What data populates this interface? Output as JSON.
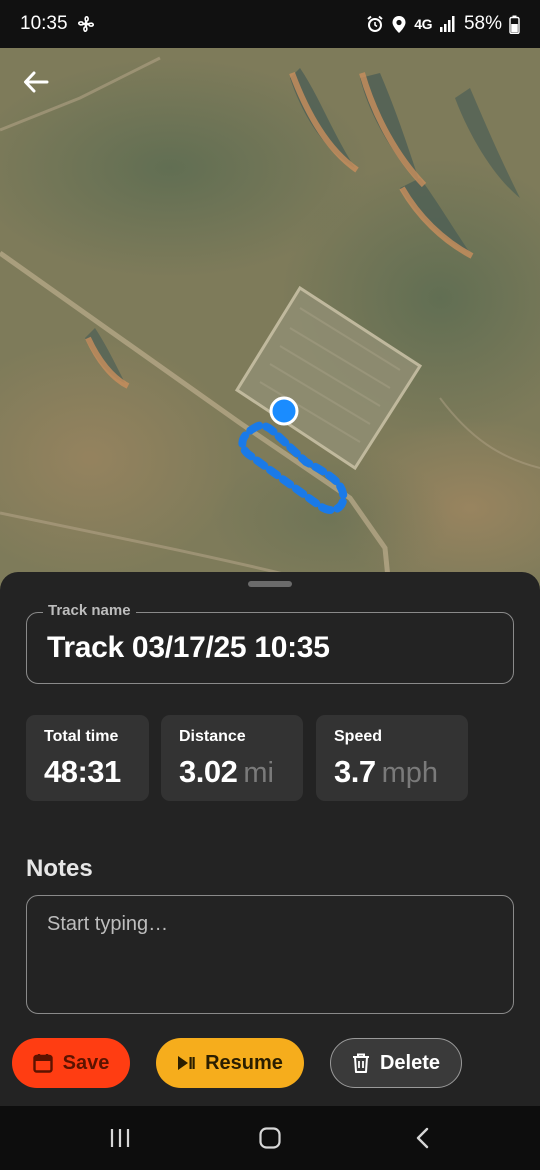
{
  "status_bar": {
    "time": "10:35",
    "network": "4G",
    "battery": "58%",
    "left_icons": [
      "fan-icon"
    ],
    "right_icons": [
      "alarm-icon",
      "location-icon",
      "signal-icon",
      "battery-icon"
    ]
  },
  "map": {
    "type": "satellite",
    "back_icon": "arrow-left-icon",
    "track_color": "#1a7ae8",
    "location_dot_color": "#1a8cff"
  },
  "track": {
    "name_label": "Track name",
    "name_value": "Track 03/17/25 10:35"
  },
  "stats": [
    {
      "label": "Total time",
      "value": "48:31",
      "unit": ""
    },
    {
      "label": "Distance",
      "value": "3.02",
      "unit": "mi"
    },
    {
      "label": "Speed",
      "value": "3.7",
      "unit": "mph"
    }
  ],
  "notes": {
    "heading": "Notes",
    "placeholder": "Start typing…",
    "value": ""
  },
  "actions": {
    "save_label": "Save",
    "resume_label": "Resume",
    "delete_label": "Delete",
    "save_color": "#ff3d12",
    "resume_color": "#f6ad1c",
    "delete_color": "#3a3a3a"
  },
  "nav_bar": {
    "icons": [
      "recent-apps-icon",
      "home-icon",
      "back-icon"
    ]
  }
}
